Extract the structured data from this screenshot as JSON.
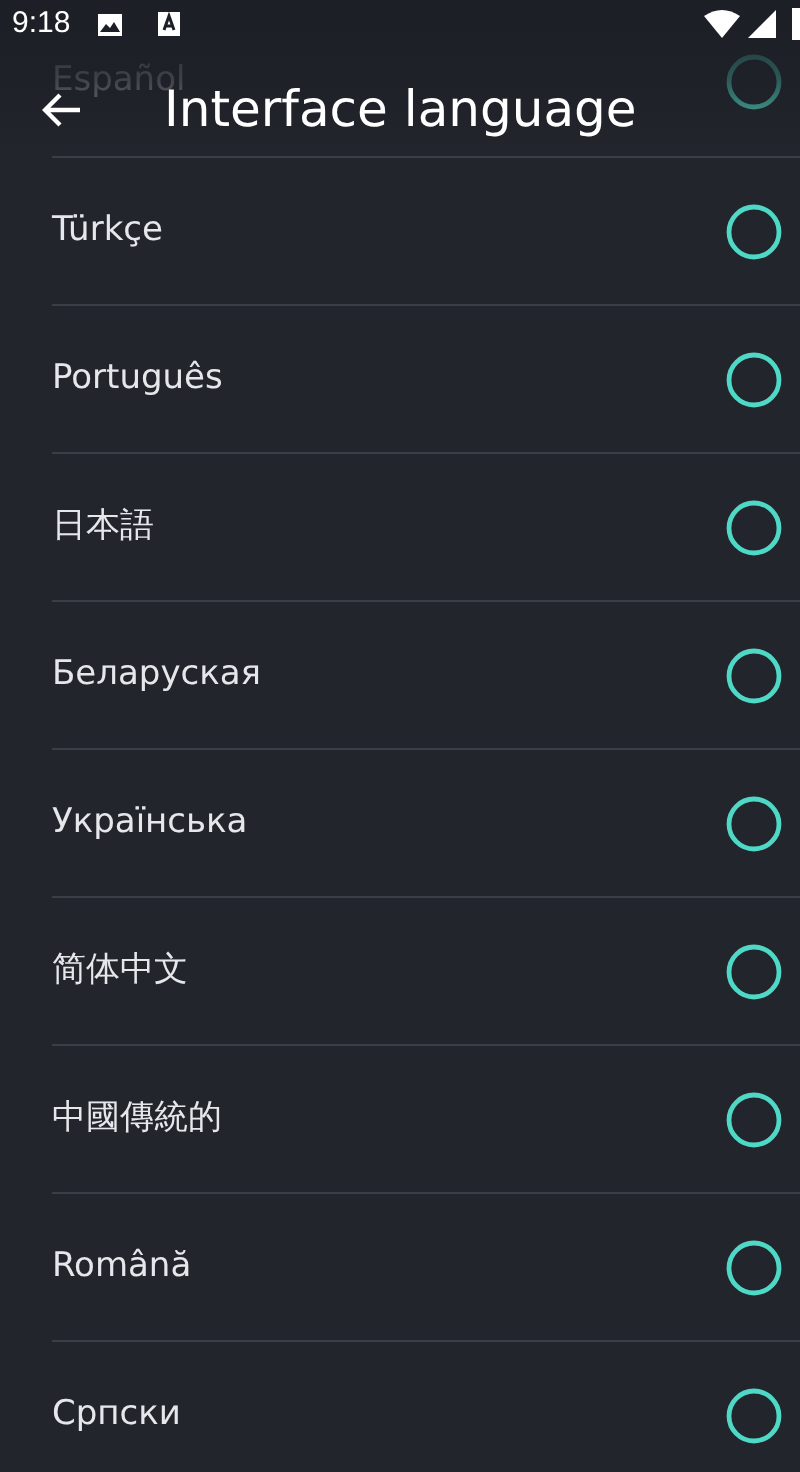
{
  "status_bar": {
    "time": "9:18"
  },
  "header": {
    "title": "Interface language"
  },
  "languages": [
    {
      "label": "Español",
      "selected": false
    },
    {
      "label": "Türkçe",
      "selected": false
    },
    {
      "label": "Português",
      "selected": false
    },
    {
      "label": "日本語",
      "selected": false
    },
    {
      "label": "Беларуская",
      "selected": false
    },
    {
      "label": "Українська",
      "selected": false
    },
    {
      "label": "简体中文",
      "selected": false
    },
    {
      "label": "中國傳統的",
      "selected": false
    },
    {
      "label": "Română",
      "selected": false
    },
    {
      "label": "Српски",
      "selected": false
    }
  ]
}
